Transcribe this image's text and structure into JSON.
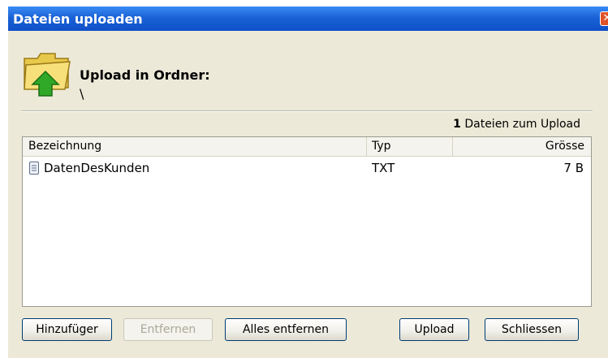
{
  "window": {
    "title": "Dateien uploaden",
    "close_glyph": "✕"
  },
  "header": {
    "title": "Upload in Ordner:",
    "path": "\\"
  },
  "summary": {
    "count": "1",
    "text": "Dateien zum Upload"
  },
  "table": {
    "columns": [
      "Bezeichnung",
      "Typ",
      "Grösse"
    ],
    "rows": [
      {
        "name": "DatenDesKunden",
        "type": "TXT",
        "size": "7 B",
        "icon": "text-file-icon"
      }
    ]
  },
  "buttons": {
    "add": "Hinzufüger",
    "remove": "Entfernen",
    "remove_all": "Alles entfernen",
    "upload": "Upload",
    "close": "Schliessen"
  },
  "icons": {
    "folder": "folder-upload-icon",
    "file": "text-file-icon",
    "close": "close-icon"
  },
  "colors": {
    "titlebar": "#0f50c8",
    "dialog_bg": "#ece9d8",
    "close": "#e0532a"
  }
}
